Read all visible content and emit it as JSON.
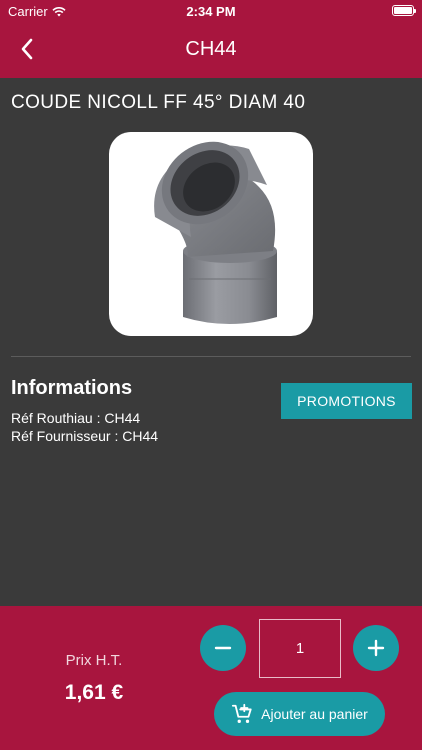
{
  "status_bar": {
    "carrier": "Carrier",
    "time": "2:34 PM"
  },
  "nav": {
    "title": "CH44",
    "back_icon": "chevron-left-icon"
  },
  "product": {
    "name": "COUDE NICOLL FF 45° DIAM 40",
    "image": "grey-pvc-45-degree-elbow-pipe",
    "info_heading": "Informations",
    "ref_routhiau": "Réf Routhiau : CH44",
    "ref_fournisseur": "Réf Fournisseur : CH44",
    "promotions_label": "PROMOTIONS"
  },
  "footer": {
    "price_label": "Prix H.T.",
    "price_value": "1,61 €",
    "quantity": "1",
    "add_to_cart_label": "Ajouter au panier"
  },
  "colors": {
    "brand": "#a8153e",
    "accent": "#1a9ba5",
    "background": "#3a3a3a"
  }
}
